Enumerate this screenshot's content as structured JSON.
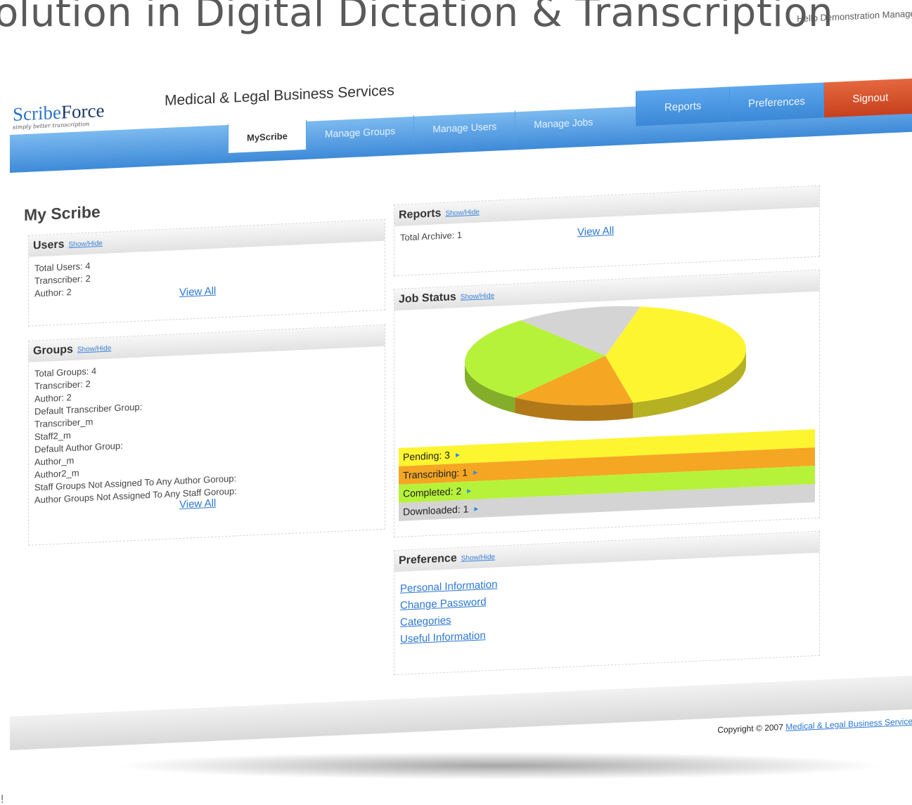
{
  "headline": "olution in Digital Dictation & Transcription",
  "exclamation": "!",
  "hello_text": "Hello Demonstration Manager",
  "logo": {
    "scribe": "Scribe",
    "force": "Force",
    "tagline": "simply better transcription"
  },
  "company_name": "Medical & Legal Business Services",
  "top_nav": [
    {
      "label": "Reports"
    },
    {
      "label": "Preferences"
    },
    {
      "label": "Signout"
    }
  ],
  "tabs": [
    {
      "label": "MyScribe"
    },
    {
      "label": "Manage Groups"
    },
    {
      "label": "Manage Users"
    },
    {
      "label": "Manage Jobs"
    }
  ],
  "page_title": "My Scribe",
  "show_hide": "Show/Hide",
  "users_panel": {
    "title": "Users",
    "lines": [
      "Total Users: 4",
      "Transcriber: 2",
      "Author: 2"
    ],
    "view_all": "View All"
  },
  "groups_panel": {
    "title": "Groups",
    "lines": [
      "Total Groups: 4",
      "Transcriber: 2",
      "Author: 2",
      "Default Transcriber Group:",
      "Transcriber_m",
      "Staff2_m",
      "Default Author Group:",
      "Author_m",
      "Author2_m",
      "Staff Groups Not Assigned To Any Author Goroup:",
      "Author Groups Not Assigned To Any Staff Goroup:"
    ],
    "view_all": "View All"
  },
  "reports_panel": {
    "title": "Reports",
    "total_archive": "Total Archive: 1",
    "view_all": "View All"
  },
  "job_status_panel": {
    "title": "Job Status",
    "statuses": [
      {
        "label": "Pending: 3",
        "color": "#fdf530",
        "value": 3
      },
      {
        "label": "Transcribing: 1",
        "color": "#f5a623",
        "value": 1
      },
      {
        "label": "Completed: 2",
        "color": "#b6f23a",
        "value": 2
      },
      {
        "label": "Downloaded: 1",
        "color": "#d4d4d4",
        "value": 1
      }
    ]
  },
  "preference_panel": {
    "title": "Preference",
    "links": [
      "Personal Information",
      "Change Password",
      "Categories",
      "Useful Information"
    ]
  },
  "footer": {
    "copyright_prefix": "Copyright © 2007",
    "copyright_link": "Medical & Legal Business Services"
  },
  "colors": {
    "nav_blue": "#4a95e0",
    "signout_red": "#d24d28",
    "link_blue": "#2c78d2"
  }
}
